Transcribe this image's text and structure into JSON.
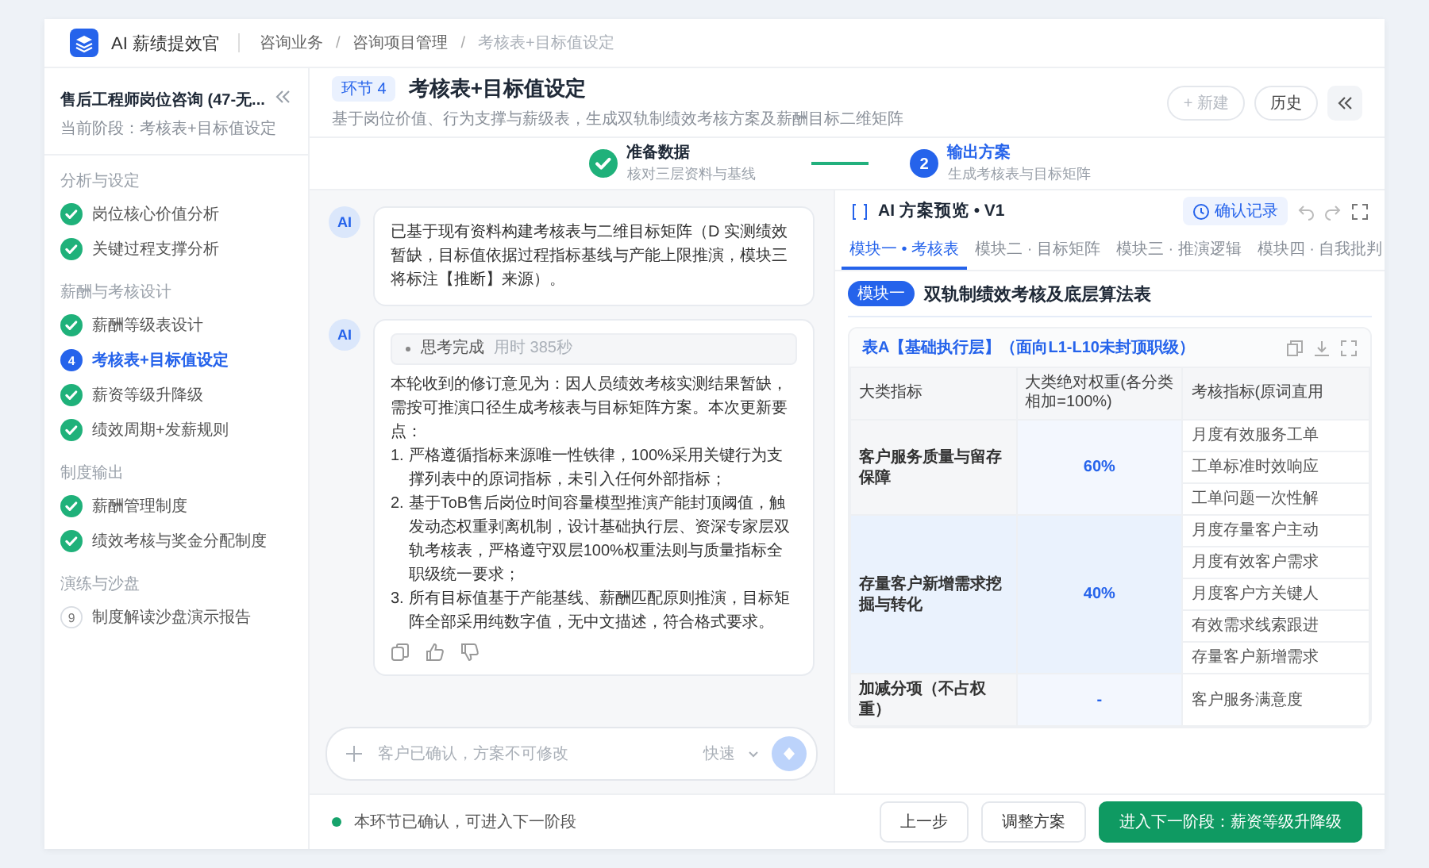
{
  "topbar": {
    "app_name": "AI 薪绩提效官",
    "breadcrumb": [
      {
        "label": "咨询业务",
        "current": false
      },
      {
        "label": "咨询项目管理",
        "current": false
      },
      {
        "label": "考核表+目标值设定",
        "current": true
      }
    ],
    "separator": "/"
  },
  "sidebar": {
    "project_title": "售后工程师岗位咨询 (47-无...",
    "current_stage": "当前阶段：考核表+目标值设定",
    "sections": [
      {
        "title": "分析与设定",
        "items": [
          {
            "label": "岗位核心价值分析",
            "kind": "done",
            "selected": false
          },
          {
            "label": "关键过程支撑分析",
            "kind": "done",
            "selected": false
          }
        ]
      },
      {
        "title": "薪酬与考核设计",
        "items": [
          {
            "label": "薪酬等级表设计",
            "kind": "done",
            "selected": false
          },
          {
            "label": "考核表+目标值设定",
            "kind": "current",
            "number": "4",
            "selected": true
          },
          {
            "label": "薪资等级升降级",
            "kind": "done",
            "selected": false
          },
          {
            "label": "绩效周期+发薪规则",
            "kind": "done",
            "selected": false
          }
        ]
      },
      {
        "title": "制度输出",
        "items": [
          {
            "label": "薪酬管理制度",
            "kind": "done",
            "selected": false
          },
          {
            "label": "绩效考核与奖金分配制度",
            "kind": "done",
            "selected": false
          }
        ]
      },
      {
        "title": "演练与沙盘",
        "items": [
          {
            "label": "制度解读沙盘演示报告",
            "kind": "pending",
            "number": "9",
            "selected": false
          }
        ]
      }
    ]
  },
  "header": {
    "stage_badge": "环节 4",
    "title": "考核表+目标值设定",
    "subtitle": "基于岗位价值、行为支撑与薪级表，生成双轨制绩效考核方案及薪酬目标二维矩阵",
    "buttons": [
      {
        "label": "+ 新建",
        "disabled": true
      },
      {
        "label": "历史",
        "disabled": false
      }
    ]
  },
  "steps": [
    {
      "title": "准备数据",
      "subtitle": "核对三层资料与基线",
      "kind": "done"
    },
    {
      "number": "2",
      "title": "输出方案",
      "subtitle": "生成考核表与目标矩阵",
      "kind": "active"
    }
  ],
  "chat": {
    "messages": [
      {
        "avatar": "AI",
        "kind": "text",
        "text": "已基于现有资料构建考核表与二维目标矩阵（D 实测绩效暂缺，目标值依据过程指标基线与产能上限推演，模块三将标注【推断】来源）。"
      },
      {
        "avatar": "AI",
        "kind": "reasoning",
        "thinking_label": "思考完成",
        "thinking_time": "用时 385秒",
        "intro": "本轮收到的修订意见为：因人员绩效考核实测结果暂缺，需按可推演口径生成考核表与目标矩阵方案。本次更新要点：",
        "points": [
          {
            "number": "1.",
            "text": "严格遵循指标来源唯一性铁律，100%采用关键行为支撑列表中的原词指标，未引入任何外部指标；"
          },
          {
            "number": "2.",
            "text": "基于ToB售后岗位时间容量模型推演产能封顶阈值，触发动态权重剥离机制，设计基础执行层、资深专家层双轨考核表，严格遵守双层100%权重法则与质量指标全职级统一要求；"
          },
          {
            "number": "3.",
            "text": "所有目标值基于产能基线、薪酬匹配原则推演，目标矩阵全部采用纯数字值，无中文描述，符合格式要求。"
          }
        ]
      }
    ],
    "input": {
      "placeholder": "客户已确认，方案不可修改",
      "mode": "快速"
    }
  },
  "preview": {
    "title": "AI 方案预览 • V1",
    "confirm_button": "确认记录",
    "tabs": [
      {
        "label": "模块一 • 考核表",
        "selected": true
      },
      {
        "label": "模块二 · 目标矩阵",
        "selected": false
      },
      {
        "label": "模块三 · 推演逻辑",
        "selected": false
      },
      {
        "label": "模块四 · 自我批判",
        "selected": false
      }
    ],
    "module_badge": "模块一",
    "module_title": "双轨制绩效考核及底层算法表",
    "table": {
      "title": "表A【基础执行层】（面向L1-L10未封顶职级）",
      "columns": [
        "大类指标",
        "大类绝对权重(各分类相加=100%)",
        "考核指标(原词直用"
      ],
      "groups": [
        {
          "category": "客户服务质量与留存保障",
          "weight": "60%",
          "metrics": [
            "月度有效服务工单",
            "工单标准时效响应",
            "工单问题一次性解"
          ]
        },
        {
          "category": "存量客户新增需求挖掘与转化",
          "weight": "40%",
          "metrics": [
            "月度存量客户主动",
            "月度有效客户需求",
            "月度客户方关键人",
            "有效需求线索跟进",
            "存量客户新增需求"
          ]
        },
        {
          "category": "加减分项（不占权重）",
          "weight": "-",
          "metrics": [
            "客户服务满意度"
          ]
        }
      ]
    }
  },
  "footer": {
    "status": "本环节已确认，可进入下一阶段",
    "buttons": [
      {
        "label": "上一步",
        "kind": "secondary"
      },
      {
        "label": "调整方案",
        "kind": "secondary"
      },
      {
        "label": "进入下一阶段：薪资等级升降级",
        "kind": "primary"
      }
    ]
  }
}
